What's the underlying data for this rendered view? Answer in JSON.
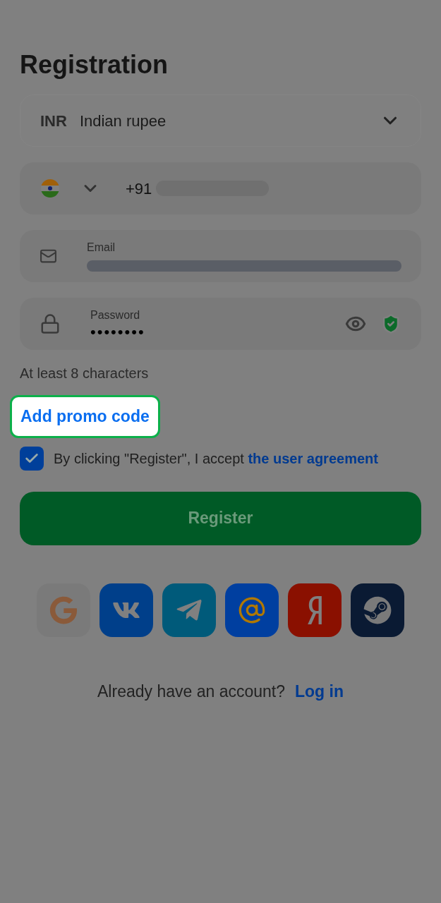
{
  "title": "Registration",
  "currency": {
    "code": "INR",
    "name": "Indian rupee"
  },
  "phone": {
    "prefix": "+91"
  },
  "email": {
    "label": "Email"
  },
  "password": {
    "label": "Password",
    "value": "••••••••",
    "strong": true
  },
  "hint": "At least 8 characters",
  "promo": {
    "label": "Add promo code",
    "highlighted": true
  },
  "agreement": {
    "checked": true,
    "text": "By clicking \"Register\", I accept",
    "link": "the user agreement"
  },
  "register_button": "Register",
  "social_logins": [
    {
      "kind": "google"
    },
    {
      "kind": "vk"
    },
    {
      "kind": "telegram"
    },
    {
      "kind": "mail"
    },
    {
      "kind": "yandex"
    },
    {
      "kind": "steam"
    }
  ],
  "footer": {
    "text": "Already have an account?",
    "link": "Log in"
  }
}
